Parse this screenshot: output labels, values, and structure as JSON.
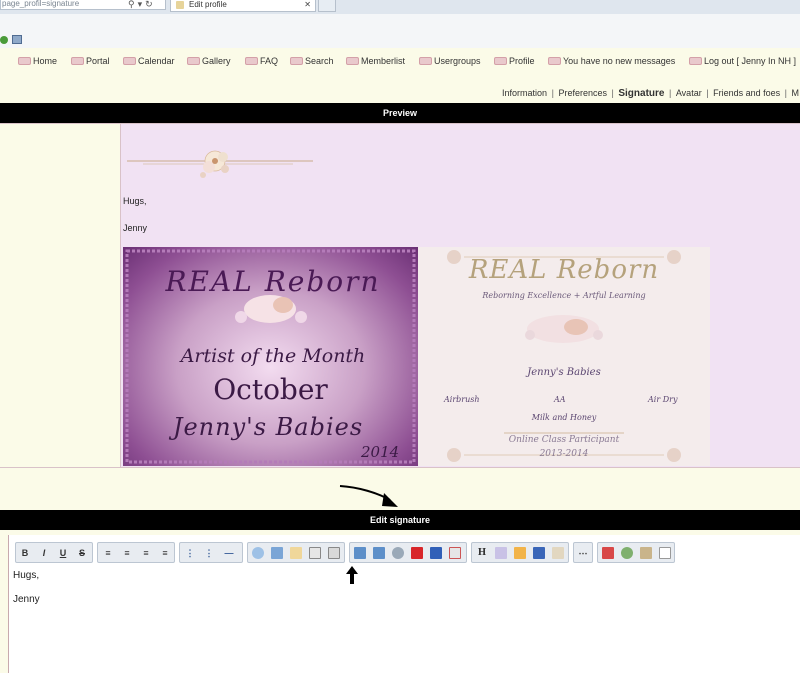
{
  "browser": {
    "address": "page_profil=signature",
    "tab_title": "Edit profile"
  },
  "nav": {
    "items": [
      {
        "label": "Home"
      },
      {
        "label": "Portal"
      },
      {
        "label": "Calendar"
      },
      {
        "label": "Gallery"
      },
      {
        "label": "FAQ"
      },
      {
        "label": "Search"
      },
      {
        "label": "Memberlist"
      },
      {
        "label": "Usergroups"
      },
      {
        "label": "Profile"
      },
      {
        "label": "You have no new messages"
      },
      {
        "label": "Log out [ Jenny In NH ]"
      }
    ]
  },
  "subnav": {
    "information": "Information",
    "preferences": "Preferences",
    "signature": "Signature",
    "avatar": "Avatar",
    "friends": "Friends and foes",
    "more": "M",
    "sep": "|"
  },
  "preview": {
    "header": "Preview",
    "line1": "Hugs,",
    "line2": "Jenny",
    "image1": {
      "top": "REAL  Reborn",
      "artist": "Artist of the Month",
      "month": "October",
      "name": "Jenny's Babies",
      "year": "2014"
    },
    "image2": {
      "title": "REAL Reborn",
      "subtitle": "Reborning Excellence + Artful Learning",
      "name": "Jenny's Babies",
      "airbrush": "Airbrush",
      "aa": "AA",
      "airdry": "Air Dry",
      "milk": "Milk and Honey",
      "class": "Online Class Participant",
      "years": "2013-2014"
    }
  },
  "editor": {
    "header": "Edit signature",
    "line1": "Hugs,",
    "line2": "Jenny",
    "buttons": {
      "bold": "B",
      "italic": "I",
      "underline": "U",
      "strike": "S",
      "heading": "H"
    }
  }
}
